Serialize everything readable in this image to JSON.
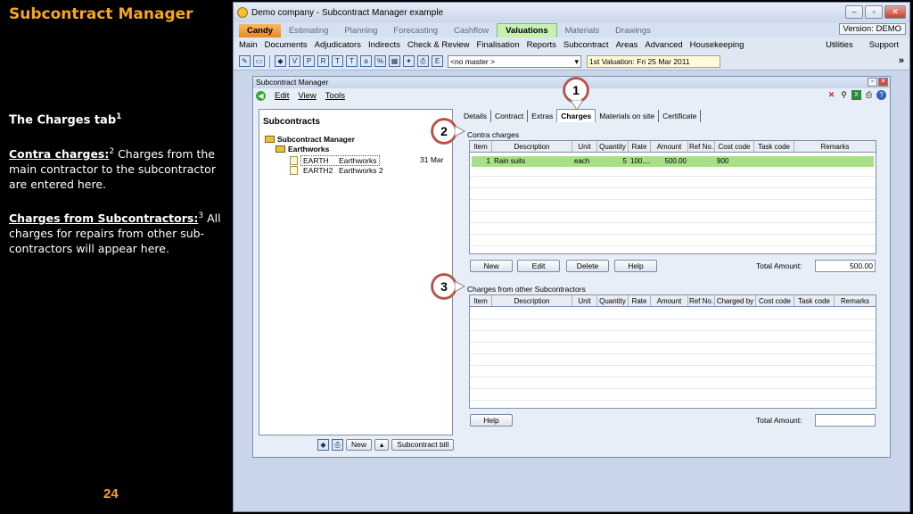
{
  "slide": {
    "title": "Subcontract Manager",
    "charges_heading": "The Charges tab",
    "charges_sup": "1",
    "contra_label": "Contra charges:",
    "contra_sup": "2",
    "contra_text": " Charges from the main contractor to the subcontractor are entered here.",
    "subs_label": "Charges from Subcontractors:",
    "subs_sup": "3",
    "subs_text": " All charges for repairs from other sub-contractors will appear here.",
    "page_number": "24"
  },
  "window": {
    "title": "Demo company - Subcontract Manager example",
    "version": "Version: DEMO"
  },
  "main_tabs": [
    "Candy",
    "Estimating",
    "Planning",
    "Forecasting",
    "Cashflow",
    "Valuations",
    "Materials",
    "Drawings"
  ],
  "menu": {
    "items": [
      "Main",
      "Documents",
      "Adjudicators",
      "Indirects",
      "Check & Review",
      "Finalisation",
      "Reports",
      "Subcontract",
      "Areas",
      "Advanced",
      "Housekeeping"
    ],
    "right": [
      "Utilities",
      "Support"
    ]
  },
  "toolbar": {
    "master": "<no master >",
    "valuation": "1st Valuation: Fri 25 Mar 2011"
  },
  "inner": {
    "title": "Subcontract Manager",
    "menu": [
      "Edit",
      "View",
      "Tools"
    ]
  },
  "tree": {
    "title": "Subcontracts",
    "root": "Subcontract Manager",
    "group": "Earthworks",
    "items": [
      {
        "code": "EARTH",
        "name": "Earthworks",
        "date": "31 Mar"
      },
      {
        "code": "EARTH2",
        "name": "Earthworks 2",
        "date": ""
      }
    ],
    "new_label": "New",
    "bill_label": "Subcontract bill"
  },
  "sub_tabs": [
    "Details",
    "Contract",
    "Extras",
    "Charges",
    "Materials on site",
    "Certificate"
  ],
  "contra": {
    "label": "Contra charges",
    "columns": [
      "Item",
      "Description",
      "Unit",
      "Quantity",
      "Rate",
      "Amount",
      "Ref No.",
      "Cost code",
      "Task code",
      "Remarks"
    ],
    "rows": [
      {
        "item": "1",
        "description": "Rain suits",
        "unit": "each",
        "quantity": "5",
        "rate": "100....",
        "amount": "500.00",
        "ref": "",
        "cost_code": "900",
        "task_code": "",
        "remarks": ""
      }
    ],
    "buttons": [
      "New",
      "Edit",
      "Delete",
      "Help"
    ],
    "total_label": "Total Amount:",
    "total": "500.00"
  },
  "others": {
    "label": "Charges from other Subcontractors",
    "columns": [
      "Item",
      "Description",
      "Unit",
      "Quantity",
      "Rate",
      "Amount",
      "Ref No.",
      "Charged by",
      "Cost code",
      "Task code",
      "Remarks"
    ],
    "help_label": "Help",
    "total_label": "Total Amount:",
    "total": ""
  },
  "callouts": [
    "1",
    "2",
    "3"
  ]
}
